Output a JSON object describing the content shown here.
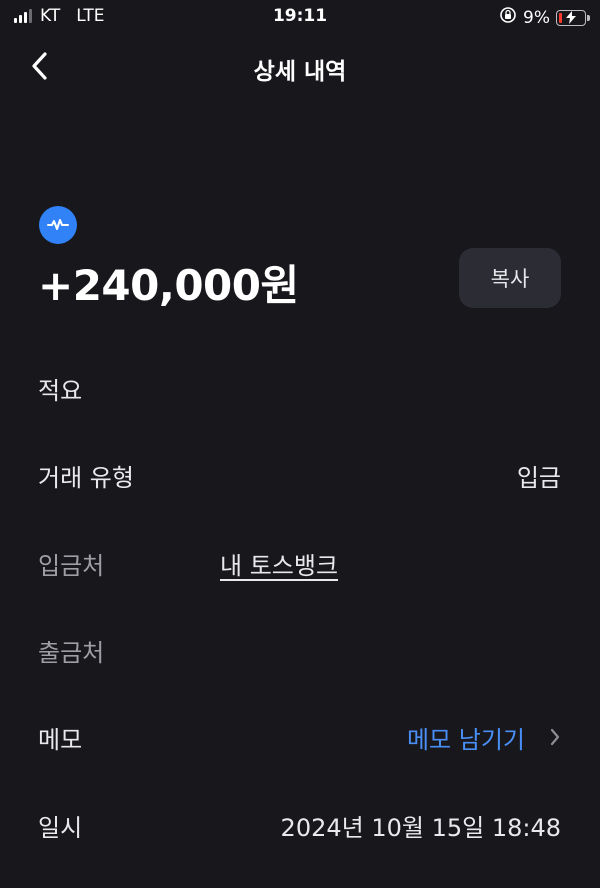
{
  "status_bar": {
    "carrier": "KT",
    "network": "LTE",
    "time": "19:11",
    "battery_percent": "9%",
    "battery_level": 0.09
  },
  "nav": {
    "title": "상세 내역"
  },
  "transaction": {
    "amount": "+240,000원",
    "copy_label": "복사",
    "bank_icon_color": "#3182f6"
  },
  "details": {
    "memo_title_label": "적요",
    "type_label": "거래 유형",
    "type_value": "입금",
    "deposit_to_label": "입금처",
    "deposit_to_value": "내 토스뱅크",
    "withdraw_from_label": "출금처",
    "memo_label": "메모",
    "memo_action": "메모 남기기",
    "datetime_label": "일시",
    "datetime_value": "2024년 10월 15일 18:48"
  },
  "colors": {
    "background": "#17171c",
    "accent": "#4a8ff7",
    "button_bg": "#2c2c35"
  }
}
